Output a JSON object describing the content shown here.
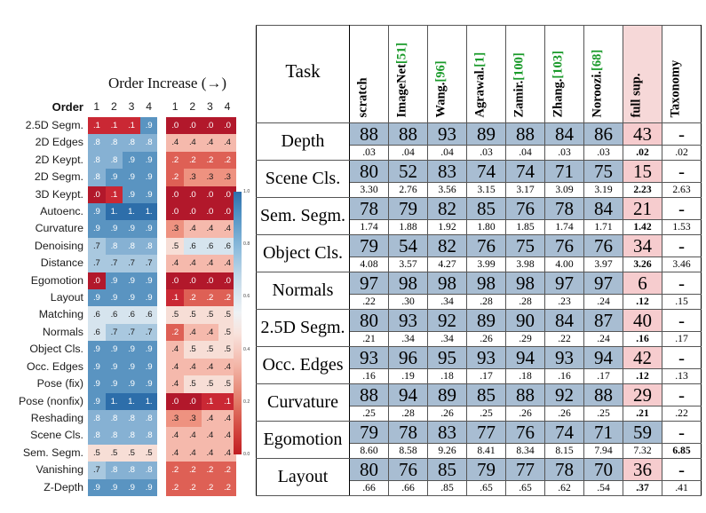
{
  "left_panel": {
    "title": "Order Increase (→)",
    "corner_label": "Order",
    "col_headers_group1": [
      "1",
      "2",
      "3",
      "4"
    ],
    "col_headers_group2": [
      "1",
      "2",
      "3",
      "4"
    ],
    "colorbar": {
      "ticks": [
        "1.0",
        "0.8",
        "0.6",
        "0.4",
        "0.2",
        "0.0"
      ],
      "top_color": "#2f6fab",
      "bottom_color": "#c01e22"
    },
    "rows": [
      {
        "label": "2.5D Segm.",
        "g1": [
          ".1",
          ".1",
          ".1",
          ".9"
        ],
        "g2": [
          ".0",
          ".0",
          ".0",
          ".0"
        ]
      },
      {
        "label": "2D Edges",
        "g1": [
          ".8",
          ".8",
          ".8",
          ".8"
        ],
        "g2": [
          ".4",
          ".4",
          ".4",
          ".4"
        ]
      },
      {
        "label": "2D Keypt.",
        "g1": [
          ".8",
          ".8",
          ".9",
          ".9"
        ],
        "g2": [
          ".2",
          ".2",
          ".2",
          ".2"
        ]
      },
      {
        "label": "2D Segm.",
        "g1": [
          ".8",
          ".9",
          ".9",
          ".9"
        ],
        "g2": [
          ".2",
          ".3",
          ".3",
          ".3"
        ]
      },
      {
        "label": "3D Keypt.",
        "g1": [
          ".0",
          ".1",
          ".9",
          ".9"
        ],
        "g2": [
          ".0",
          ".0",
          ".0",
          ".0"
        ]
      },
      {
        "label": "Autoenc.",
        "g1": [
          ".9",
          "1.",
          "1.",
          "1."
        ],
        "g2": [
          ".0",
          ".0",
          ".0",
          ".0"
        ]
      },
      {
        "label": "Curvature",
        "g1": [
          ".9",
          ".9",
          ".9",
          ".9"
        ],
        "g2": [
          ".3",
          ".4",
          ".4",
          ".4"
        ]
      },
      {
        "label": "Denoising",
        "g1": [
          ".7",
          ".8",
          ".8",
          ".8"
        ],
        "g2": [
          ".5",
          ".6",
          ".6",
          ".6"
        ]
      },
      {
        "label": "Distance",
        "g1": [
          ".7",
          ".7",
          ".7",
          ".7"
        ],
        "g2": [
          ".4",
          ".4",
          ".4",
          ".4"
        ]
      },
      {
        "label": "Egomotion",
        "g1": [
          ".0",
          ".9",
          ".9",
          ".9"
        ],
        "g2": [
          ".0",
          ".0",
          ".0",
          ".0"
        ]
      },
      {
        "label": "Layout",
        "g1": [
          ".9",
          ".9",
          ".9",
          ".9"
        ],
        "g2": [
          ".1",
          ".2",
          ".2",
          ".2"
        ]
      },
      {
        "label": "Matching",
        "g1": [
          ".6",
          ".6",
          ".6",
          ".6"
        ],
        "g2": [
          ".5",
          ".5",
          ".5",
          ".5"
        ]
      },
      {
        "label": "Normals",
        "g1": [
          ".6",
          ".7",
          ".7",
          ".7"
        ],
        "g2": [
          ".2",
          ".4",
          ".4",
          ".5"
        ]
      },
      {
        "label": "Object Cls.",
        "g1": [
          ".9",
          ".9",
          ".9",
          ".9"
        ],
        "g2": [
          ".4",
          ".5",
          ".5",
          ".5"
        ]
      },
      {
        "label": "Occ. Edges",
        "g1": [
          ".9",
          ".9",
          ".9",
          ".9"
        ],
        "g2": [
          ".4",
          ".4",
          ".4",
          ".4"
        ]
      },
      {
        "label": "Pose (fix)",
        "g1": [
          ".9",
          ".9",
          ".9",
          ".9"
        ],
        "g2": [
          ".4",
          ".5",
          ".5",
          ".5"
        ]
      },
      {
        "label": "Pose (nonfix)",
        "g1": [
          ".9",
          "1.",
          "1.",
          "1."
        ],
        "g2": [
          ".0",
          ".0",
          ".1",
          ".1"
        ]
      },
      {
        "label": "Reshading",
        "g1": [
          ".8",
          ".8",
          ".8",
          ".8"
        ],
        "g2": [
          ".3",
          ".3",
          ".4",
          ".4"
        ]
      },
      {
        "label": "Scene Cls.",
        "g1": [
          ".8",
          ".8",
          ".8",
          ".8"
        ],
        "g2": [
          ".4",
          ".4",
          ".4",
          ".4"
        ]
      },
      {
        "label": "Sem. Segm.",
        "g1": [
          ".5",
          ".5",
          ".5",
          ".5"
        ],
        "g2": [
          ".4",
          ".4",
          ".4",
          ".4"
        ]
      },
      {
        "label": "Vanishing",
        "g1": [
          ".7",
          ".8",
          ".8",
          ".8"
        ],
        "g2": [
          ".2",
          ".2",
          ".2",
          ".2"
        ]
      },
      {
        "label": "Z-Depth",
        "g1": [
          ".9",
          ".9",
          ".9",
          ".9"
        ],
        "g2": [
          ".2",
          ".2",
          ".2",
          ".2"
        ]
      }
    ]
  },
  "right_panel": {
    "task_header": "Task",
    "columns": [
      {
        "name": "scratch",
        "cite": ""
      },
      {
        "name": "ImageNet",
        "cite": "[51]"
      },
      {
        "name": "Wang.",
        "cite": "[96]"
      },
      {
        "name": "Agrawal.",
        "cite": "[1]"
      },
      {
        "name": "Zamir.",
        "cite": "[100]"
      },
      {
        "name": "Zhang.",
        "cite": "[103]"
      },
      {
        "name": "Noroozi.",
        "cite": "[68]"
      },
      {
        "name": "full sup.",
        "cite": ""
      },
      {
        "name": "Taxonomy",
        "cite": ""
      }
    ],
    "rows": [
      {
        "task": "Depth",
        "win": [
          "88",
          "88",
          "93",
          "89",
          "88",
          "84",
          "86",
          "43",
          "-"
        ],
        "win_fill": [
          "blue",
          "blue",
          "blue",
          "blue",
          "blue",
          "blue",
          "blue",
          "pink",
          "white"
        ],
        "loss": [
          ".03",
          ".04",
          ".04",
          ".03",
          ".04",
          ".03",
          ".03",
          ".02",
          ".02"
        ],
        "loss_bold": [
          false,
          false,
          false,
          false,
          false,
          false,
          false,
          true,
          false
        ]
      },
      {
        "task": "Scene Cls.",
        "win": [
          "80",
          "52",
          "83",
          "74",
          "74",
          "71",
          "75",
          "15",
          "-"
        ],
        "win_fill": [
          "blue",
          "blue",
          "blue",
          "blue",
          "blue",
          "blue",
          "blue",
          "pink",
          "white"
        ],
        "loss": [
          "3.30",
          "2.76",
          "3.56",
          "3.15",
          "3.17",
          "3.09",
          "3.19",
          "2.23",
          "2.63"
        ],
        "loss_bold": [
          false,
          false,
          false,
          false,
          false,
          false,
          false,
          true,
          false
        ]
      },
      {
        "task": "Sem. Segm.",
        "win": [
          "78",
          "79",
          "82",
          "85",
          "76",
          "78",
          "84",
          "21",
          "-"
        ],
        "win_fill": [
          "blue",
          "blue",
          "blue",
          "blue",
          "blue",
          "blue",
          "blue",
          "pink",
          "white"
        ],
        "loss": [
          "1.74",
          "1.88",
          "1.92",
          "1.80",
          "1.85",
          "1.74",
          "1.71",
          "1.42",
          "1.53"
        ],
        "loss_bold": [
          false,
          false,
          false,
          false,
          false,
          false,
          false,
          true,
          false
        ]
      },
      {
        "task": "Object Cls.",
        "win": [
          "79",
          "54",
          "82",
          "76",
          "75",
          "76",
          "76",
          "34",
          "-"
        ],
        "win_fill": [
          "blue",
          "blue",
          "blue",
          "blue",
          "blue",
          "blue",
          "blue",
          "pink",
          "white"
        ],
        "loss": [
          "4.08",
          "3.57",
          "4.27",
          "3.99",
          "3.98",
          "4.00",
          "3.97",
          "3.26",
          "3.46"
        ],
        "loss_bold": [
          false,
          false,
          false,
          false,
          false,
          false,
          false,
          true,
          false
        ]
      },
      {
        "task": "Normals",
        "win": [
          "97",
          "98",
          "98",
          "98",
          "98",
          "97",
          "97",
          "6",
          "-"
        ],
        "win_fill": [
          "blue",
          "blue",
          "blue",
          "blue",
          "blue",
          "blue",
          "blue",
          "pink",
          "white"
        ],
        "loss": [
          ".22",
          ".30",
          ".34",
          ".28",
          ".28",
          ".23",
          ".24",
          ".12",
          ".15"
        ],
        "loss_bold": [
          false,
          false,
          false,
          false,
          false,
          false,
          false,
          true,
          false
        ]
      },
      {
        "task": "2.5D Segm.",
        "win": [
          "80",
          "93",
          "92",
          "89",
          "90",
          "84",
          "87",
          "40",
          "-"
        ],
        "win_fill": [
          "blue",
          "blue",
          "blue",
          "blue",
          "blue",
          "blue",
          "blue",
          "pink",
          "white"
        ],
        "loss": [
          ".21",
          ".34",
          ".34",
          ".26",
          ".29",
          ".22",
          ".24",
          ".16",
          ".17"
        ],
        "loss_bold": [
          false,
          false,
          false,
          false,
          false,
          false,
          false,
          true,
          false
        ]
      },
      {
        "task": "Occ. Edges",
        "win": [
          "93",
          "96",
          "95",
          "93",
          "94",
          "93",
          "94",
          "42",
          "-"
        ],
        "win_fill": [
          "blue",
          "blue",
          "blue",
          "blue",
          "blue",
          "blue",
          "blue",
          "pink",
          "white"
        ],
        "loss": [
          ".16",
          ".19",
          ".18",
          ".17",
          ".18",
          ".16",
          ".17",
          ".12",
          ".13"
        ],
        "loss_bold": [
          false,
          false,
          false,
          false,
          false,
          false,
          false,
          true,
          false
        ]
      },
      {
        "task": "Curvature",
        "win": [
          "88",
          "94",
          "89",
          "85",
          "88",
          "92",
          "88",
          "29",
          "-"
        ],
        "win_fill": [
          "blue",
          "blue",
          "blue",
          "blue",
          "blue",
          "blue",
          "blue",
          "pink",
          "white"
        ],
        "loss": [
          ".25",
          ".28",
          ".26",
          ".25",
          ".26",
          ".26",
          ".25",
          ".21",
          ".22"
        ],
        "loss_bold": [
          false,
          false,
          false,
          false,
          false,
          false,
          false,
          true,
          false
        ]
      },
      {
        "task": "Egomotion",
        "win": [
          "79",
          "78",
          "83",
          "77",
          "76",
          "74",
          "71",
          "59",
          "-"
        ],
        "win_fill": [
          "blue",
          "blue",
          "blue",
          "blue",
          "blue",
          "blue",
          "blue",
          "blue",
          "white"
        ],
        "loss": [
          "8.60",
          "8.58",
          "9.26",
          "8.41",
          "8.34",
          "8.15",
          "7.94",
          "7.32",
          "6.85"
        ],
        "loss_bold": [
          false,
          false,
          false,
          false,
          false,
          false,
          false,
          false,
          true
        ]
      },
      {
        "task": "Layout",
        "win": [
          "80",
          "76",
          "85",
          "79",
          "77",
          "78",
          "70",
          "36",
          "-"
        ],
        "win_fill": [
          "blue",
          "blue",
          "blue",
          "blue",
          "blue",
          "blue",
          "blue",
          "pink",
          "white"
        ],
        "loss": [
          ".66",
          ".66",
          ".85",
          ".65",
          ".65",
          ".62",
          ".54",
          ".37",
          ".41"
        ],
        "loss_bold": [
          false,
          false,
          false,
          false,
          false,
          false,
          false,
          true,
          false
        ]
      }
    ]
  }
}
